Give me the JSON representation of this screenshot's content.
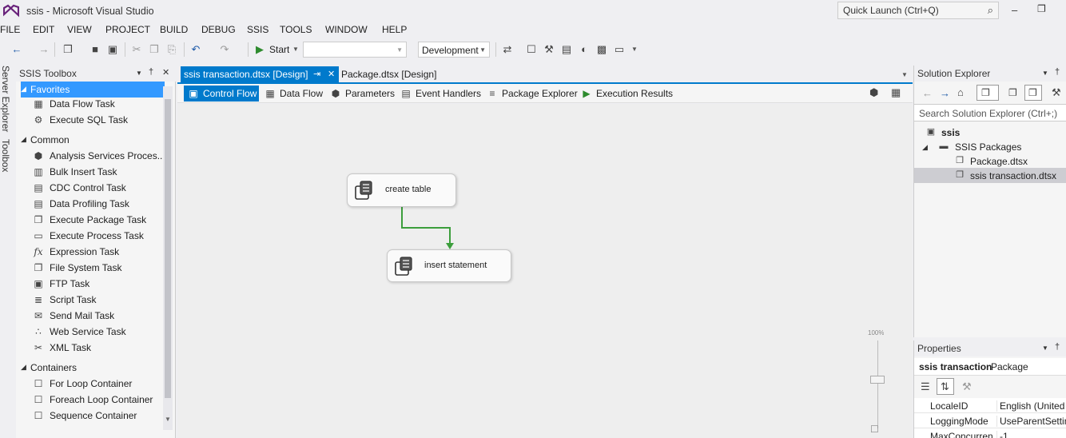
{
  "window": {
    "title": "ssis - Microsoft Visual Studio",
    "quick_launch_placeholder": "Quick Launch (Ctrl+Q)"
  },
  "menu": [
    "FILE",
    "EDIT",
    "VIEW",
    "PROJECT",
    "BUILD",
    "DEBUG",
    "SSIS",
    "TOOLS",
    "WINDOW",
    "HELP"
  ],
  "toolbar": {
    "start_label": "Start",
    "configuration_value": "Development"
  },
  "side_tabs": [
    "Server Explorer",
    "Toolbox"
  ],
  "toolbox": {
    "title": "SSIS Toolbox",
    "groups": [
      {
        "name": "Favorites",
        "items": [
          "Data Flow Task",
          "Execute SQL Task"
        ]
      },
      {
        "name": "Common",
        "items": [
          "Analysis Services Proces...",
          "Bulk Insert Task",
          "CDC Control Task",
          "Data Profiling Task",
          "Execute Package Task",
          "Execute Process Task",
          "Expression Task",
          "File System Task",
          "FTP Task",
          "Script Task",
          "Send Mail Task",
          "Web Service Task",
          "XML Task"
        ]
      },
      {
        "name": "Containers",
        "items": [
          "For Loop Container",
          "Foreach Loop Container",
          "Sequence Container"
        ]
      }
    ]
  },
  "document_tabs": [
    "ssis transaction.dtsx [Design]",
    "Package.dtsx [Design]"
  ],
  "designer_tabs": [
    "Control Flow",
    "Data Flow",
    "Parameters",
    "Event Handlers",
    "Package Explorer",
    "Execution Results"
  ],
  "canvas": {
    "tasks": [
      "create table",
      "insert statement"
    ],
    "zoom_label": "100%",
    "colors": {
      "precedence_constraint": "#3c9e3c",
      "accent": "#007acc"
    }
  },
  "solution_explorer": {
    "title": "Solution Explorer",
    "search_placeholder": "Search Solution Explorer (Ctrl+;)",
    "tree": {
      "project": "ssis",
      "folder": "SSIS Packages",
      "files": [
        "Package.dtsx",
        "ssis transaction.dtsx"
      ]
    }
  },
  "properties": {
    "title": "Properties",
    "object_name": "ssis transaction",
    "object_type": "Package",
    "rows": [
      {
        "key": "LocaleID",
        "value": "English (United S"
      },
      {
        "key": "LoggingMode",
        "value": "UseParentSetting"
      },
      {
        "key": "MaxConcurren",
        "value": "-1"
      }
    ]
  }
}
